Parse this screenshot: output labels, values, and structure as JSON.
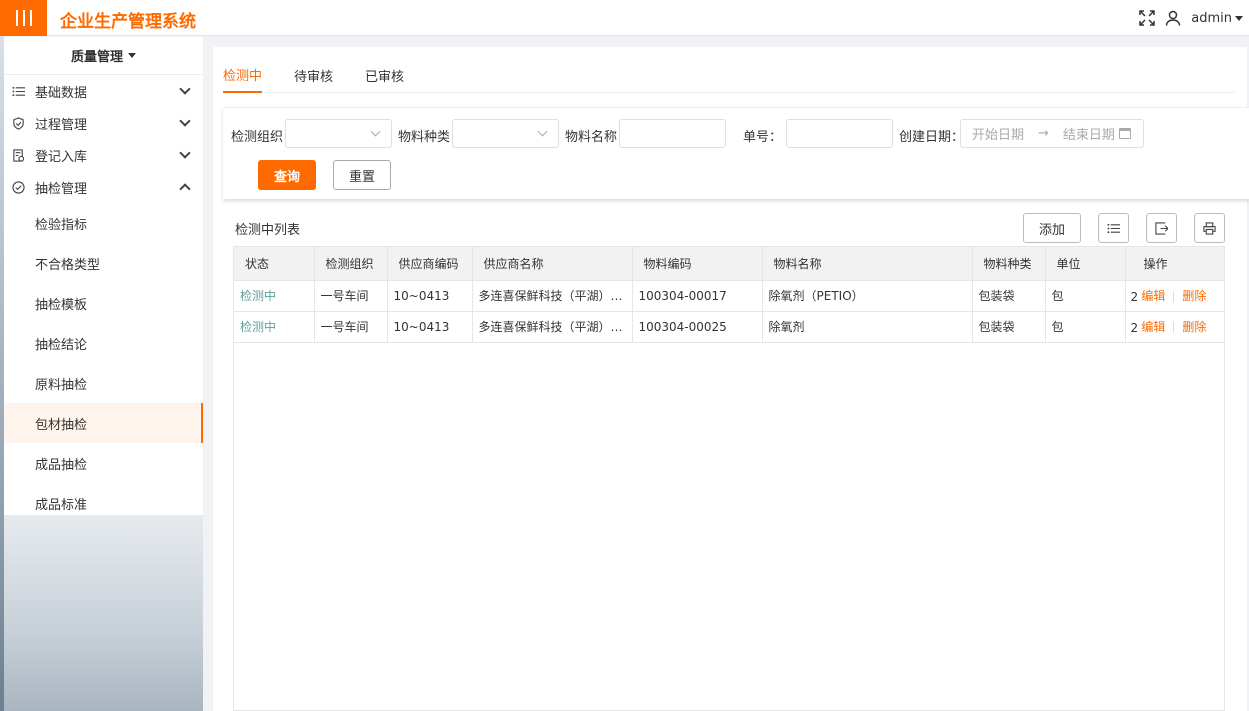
{
  "app": {
    "title": "企业生产管理系统",
    "user": "admin"
  },
  "sidebar": {
    "header": "质量管理",
    "items": [
      {
        "label": "基础数据",
        "icon": "list-icon",
        "expanded": false
      },
      {
        "label": "过程管理",
        "icon": "shield-icon",
        "expanded": false
      },
      {
        "label": "登记入库",
        "icon": "clipboard-icon",
        "expanded": false
      },
      {
        "label": "抽检管理",
        "icon": "check-circle-icon",
        "expanded": true
      }
    ],
    "subitems": [
      "检验指标",
      "不合格类型",
      "抽检模板",
      "抽检结论",
      "原料抽检",
      "包材抽检",
      "成品抽检",
      "成品标准"
    ],
    "active_subitem": "包材抽检"
  },
  "tabs": [
    "检测中",
    "待审核",
    "已审核"
  ],
  "active_tab": "检测中",
  "filters": {
    "org_label": "检测组织",
    "category_label": "物料种类",
    "name_label": "物料名称",
    "number_label": "单号：",
    "date_label": "创建日期：",
    "date_start_placeholder": "开始日期",
    "date_arrow": "→",
    "date_end_placeholder": "结束日期",
    "query_button": "查询",
    "reset_button": "重置"
  },
  "list": {
    "title": "检测中列表",
    "add_button": "添加",
    "columns": [
      "状态",
      "检测组织",
      "供应商编码",
      "供应商名称",
      "物料编码",
      "物料名称",
      "物料种类",
      "单位",
      "操作"
    ],
    "rows": [
      {
        "status": "检测中",
        "org": "一号车间",
        "supplier_code": "10~0413",
        "supplier_name": "多连喜保鲜科技（平湖）有限公司",
        "material_code": "100304-00017",
        "material_name": "除氧剂（PETIO）",
        "category": "包装袋",
        "unit": "包",
        "op_truncated": "2",
        "edit": "编辑",
        "delete": "删除"
      },
      {
        "status": "检测中",
        "org": "一号车间",
        "supplier_code": "10~0413",
        "supplier_name": "多连喜保鲜科技（平湖）有限公司",
        "material_code": "100304-00025",
        "material_name": "除氧剂",
        "category": "包装袋",
        "unit": "包",
        "op_truncated": "2",
        "edit": "编辑",
        "delete": "删除"
      }
    ]
  },
  "colors": {
    "accent": "#ff6a00",
    "status_text": "#5f9ea0"
  }
}
